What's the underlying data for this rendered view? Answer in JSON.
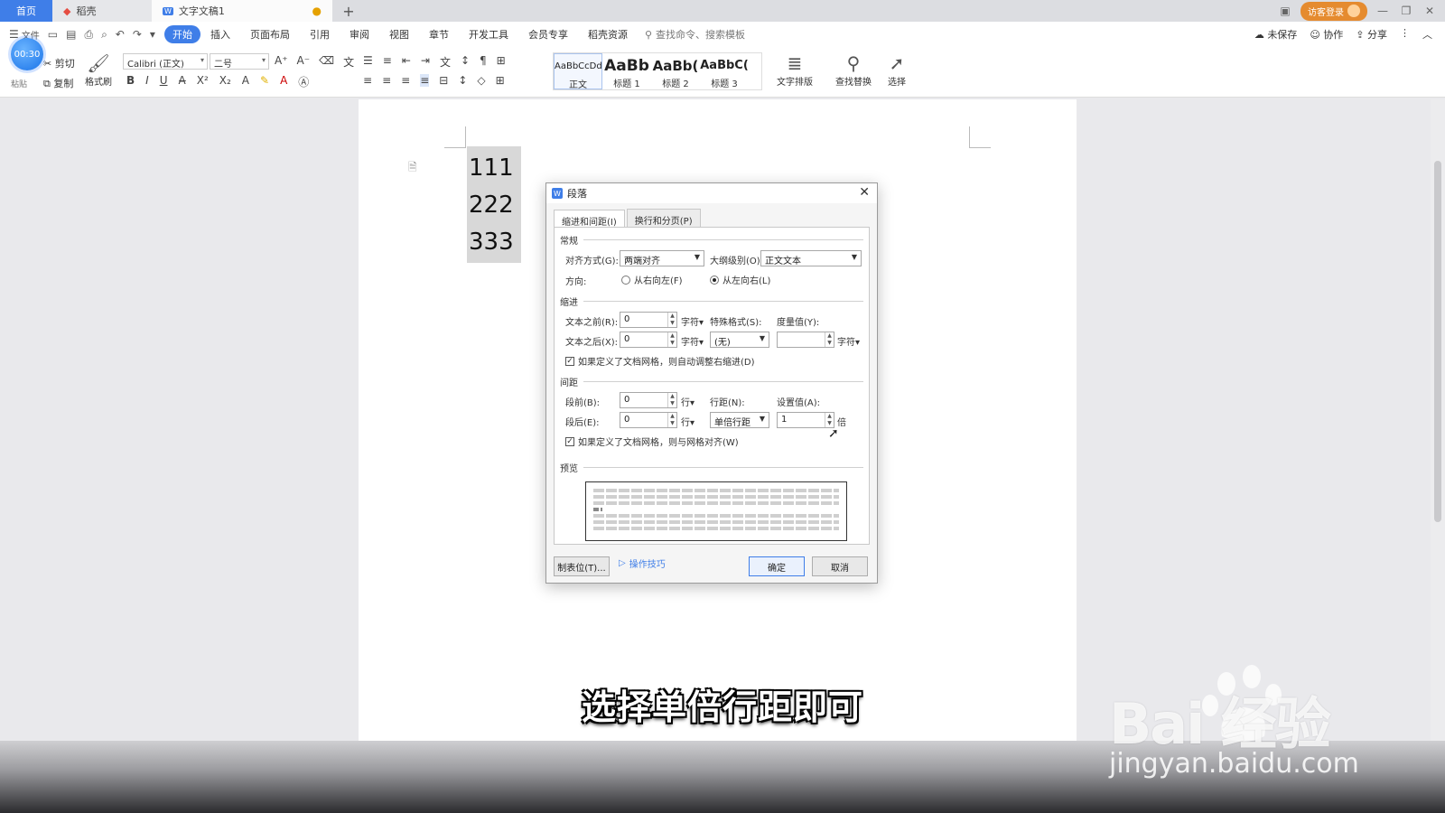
{
  "tabs": {
    "home": "首页",
    "shell": "稻壳",
    "doc": "文字文稿1",
    "doc_dot": "●",
    "add": "+"
  },
  "titlebar": {
    "guest_login": "访客登录"
  },
  "ribbon": {
    "menus": [
      "开始",
      "插入",
      "页面布局",
      "引用",
      "审阅",
      "视图",
      "章节",
      "开发工具",
      "会员专享",
      "稻壳资源"
    ],
    "file_label": "文件",
    "search_placeholder": "查找命令、搜索模板",
    "unsaved": "未保存",
    "collab": "协作",
    "share": "分享"
  },
  "toolbar": {
    "timer": "00:30",
    "cut": "剪切",
    "copy": "复制",
    "paste": "粘贴",
    "format_painter": "格式刷",
    "font_name": "Calibri (正文)",
    "font_size": "二号",
    "styles": [
      {
        "preview": "AaBbCcDd",
        "name": "正文"
      },
      {
        "preview": "AaBb",
        "name": "标题 1"
      },
      {
        "preview": "AaBb(",
        "name": "标题 2"
      },
      {
        "preview": "AaBbC(",
        "name": "标题 3"
      }
    ],
    "text_layout": "文字排版",
    "find_replace": "查找替换",
    "select": "选择"
  },
  "document": {
    "lines": [
      "111",
      "222",
      "333"
    ]
  },
  "dialog": {
    "title": "段落",
    "tabs": [
      "缩进和间距(I)",
      "换行和分页(P)"
    ],
    "general": "常规",
    "alignment_label": "对齐方式(G):",
    "alignment_value": "两端对齐",
    "outline_label": "大纲级别(O):",
    "outline_value": "正文文本",
    "direction_label": "方向:",
    "rtl": "从右向左(F)",
    "ltr": "从左向右(L)",
    "indent": "缩进",
    "before_text_label": "文本之前(R):",
    "before_text_value": "0",
    "after_text_label": "文本之后(X):",
    "after_text_value": "0",
    "unit_char": "字符",
    "special_label": "特殊格式(S):",
    "special_value": "(无)",
    "measure_label": "度量值(Y):",
    "measure_value": "",
    "auto_indent_check": "如果定义了文档网格，则自动调整右缩进(D)",
    "spacing": "间距",
    "before_label": "段前(B):",
    "before_value": "0",
    "after_label": "段后(E):",
    "after_value": "0",
    "unit_line": "行",
    "line_spacing_label": "行距(N):",
    "line_spacing_value": "单倍行距",
    "set_value_label": "设置值(A):",
    "set_value": "1",
    "unit_times": "倍",
    "grid_check": "如果定义了文档网格，则与网格对齐(W)",
    "preview": "预览",
    "tabs_button": "制表位(T)...",
    "tips": "操作技巧",
    "ok": "确定",
    "cancel": "取消"
  },
  "caption": "选择单倍行距即可",
  "watermark": {
    "brand": "Bai  经验",
    "url": "jingyan.baidu.com"
  }
}
